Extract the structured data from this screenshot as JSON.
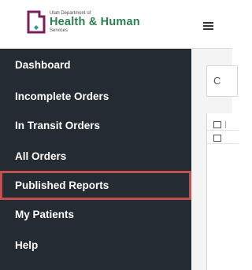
{
  "branding": {
    "org_line": "Utah Department of",
    "name_line": "Health & Human",
    "sub_line": "Services",
    "accent_color": "#2e7d50",
    "mark_color": "#7a1f5c",
    "mark_accent": "#2a9d8f"
  },
  "header": {
    "menu_icon": "hamburger-menu-icon"
  },
  "sidebar": {
    "items": [
      {
        "label": "Dashboard"
      },
      {
        "label": "Incomplete Orders"
      },
      {
        "label": "In Transit Orders"
      },
      {
        "label": "All Orders"
      },
      {
        "label": "Published Reports",
        "highlighted": true
      },
      {
        "label": "My Patients"
      },
      {
        "label": "Help"
      }
    ],
    "background_color": "#232b33",
    "highlight_color": "#c0504d"
  },
  "content": {
    "search_partial_text": "C"
  }
}
